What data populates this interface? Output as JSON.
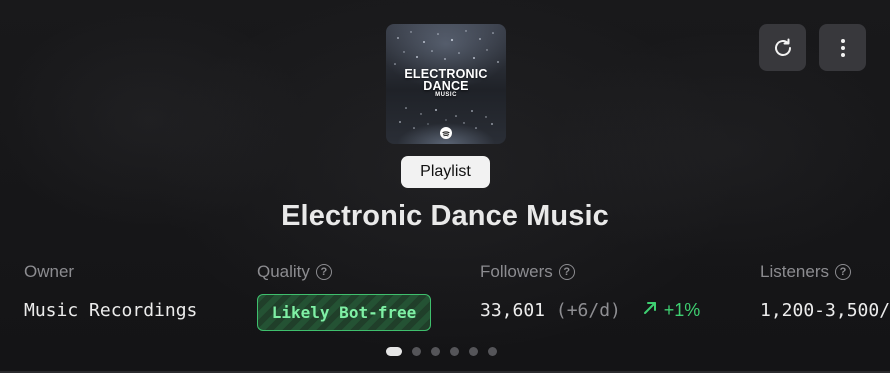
{
  "header": {
    "refresh_icon": "refresh-icon",
    "more_icon": "more-vertical-icon"
  },
  "cover": {
    "line1": "ELECTRONIC",
    "line2": "DANCE",
    "line3": "MUSIC",
    "logo_icon": "spotify-icon"
  },
  "badge": "Playlist",
  "title": "Electronic Dance Music",
  "stats": {
    "owner": {
      "label": "Owner",
      "value": "Music Recordings"
    },
    "quality": {
      "label": "Quality",
      "value": "Likely Bot-free",
      "help_icon": "help-icon"
    },
    "followers": {
      "label": "Followers",
      "count": "33,601",
      "per_day": "(+6/d)",
      "change": "+1%",
      "trend_icon": "arrow-up-right-icon",
      "help_icon": "help-icon"
    },
    "listeners": {
      "label": "Listeners",
      "value": "1,200-3,500/",
      "help_icon": "help-icon"
    }
  },
  "pagination": {
    "total": 6,
    "active": 1
  },
  "colors": {
    "background": "#161618",
    "accent_green": "#3ecf71",
    "muted": "#8c8c90",
    "button_bg": "#38383c"
  }
}
